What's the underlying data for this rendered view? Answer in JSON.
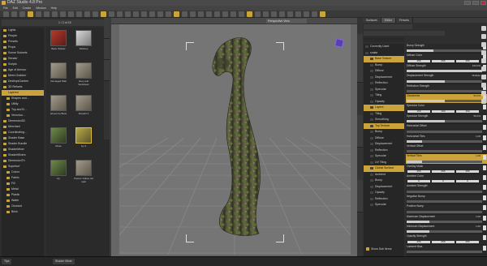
{
  "window": {
    "title": "DAZ Studio 4.8 Pro"
  },
  "menu": [
    "File",
    "Edit",
    "Create",
    "Window",
    "Help"
  ],
  "left_panel": {
    "path_label": "1 / 2 of 15",
    "tree": [
      {
        "label": "Lights"
      },
      {
        "label": "People"
      },
      {
        "label": "Presets"
      },
      {
        "label": "Props"
      },
      {
        "label": "Scene Subsets"
      },
      {
        "label": "Render"
      },
      {
        "label": "Scripts"
      },
      {
        "label": "Age of Armour"
      },
      {
        "label": "Mesh Grabber"
      },
      {
        "label": "DestinysGarden"
      },
      {
        "label": "3D Refuels"
      },
      {
        "label": "Layered",
        "selected": true
      },
      {
        "label": "Shapes and..."
      },
      {
        "label": "Utility"
      },
      {
        "label": "Top and B..."
      },
      {
        "label": "Veronica..."
      },
      {
        "label": "Dimension3D"
      },
      {
        "label": "Merchant"
      },
      {
        "label": "Coordinating..."
      },
      {
        "label": "Shader Base"
      },
      {
        "label": "Shader Bundle"
      },
      {
        "label": "ShaderMixer"
      },
      {
        "label": "ShaderMixers"
      },
      {
        "label": "DimensionTh"
      },
      {
        "label": "Superturf"
      },
      {
        "label": "Colors"
      },
      {
        "label": "Fabric"
      },
      {
        "label": "Fill"
      },
      {
        "label": "Metal"
      },
      {
        "label": "Plastic"
      },
      {
        "label": "Water"
      },
      {
        "label": "Cloward"
      },
      {
        "label": "Brick"
      }
    ],
    "thumbs": [
      {
        "label": "Base Shader"
      },
      {
        "label": "Stitches"
      },
      {
        "label": "Damaged Wall"
      },
      {
        "label": "Grey and Seamless"
      },
      {
        "label": "Ghost Ice Brick"
      },
      {
        "label": "Scratch 2"
      },
      {
        "label": "Moss"
      },
      {
        "label": "Ivy 2"
      },
      {
        "label": "Ivy"
      },
      {
        "label": "Pavers Yellow old wall"
      }
    ]
  },
  "viewport": {
    "view_label": "Perspective View"
  },
  "right_panel": {
    "tabs": [
      "Surfaces",
      "Editor",
      "Presets"
    ],
    "tree": [
      {
        "label": "Currently Used"
      },
      {
        "label": "snake"
      },
      {
        "label": "Base Texture",
        "selected": true
      },
      {
        "label": "Bump"
      },
      {
        "label": "Diffuse"
      },
      {
        "label": "Displacement"
      },
      {
        "label": "Reflection"
      },
      {
        "label": "Specular"
      },
      {
        "label": "Tiling"
      },
      {
        "label": "Opacity"
      },
      {
        "label": "Layers",
        "selected": true
      },
      {
        "label": "Tiling"
      },
      {
        "label": "Smoothing"
      },
      {
        "label": "Top Texture",
        "selected": true
      },
      {
        "label": "Bump"
      },
      {
        "label": "Diffuse"
      },
      {
        "label": "Displacement"
      },
      {
        "label": "Reflection"
      },
      {
        "label": "Specular"
      },
      {
        "label": "UV Tiling"
      },
      {
        "label": "Global Surface",
        "selected": true
      },
      {
        "label": "Ambient"
      },
      {
        "label": "Bump"
      },
      {
        "label": "Displacement"
      },
      {
        "label": "Opacity"
      },
      {
        "label": "Reflection"
      },
      {
        "label": "Specular"
      }
    ],
    "props": [
      {
        "label": "Bump Strength",
        "value": "",
        "fill": 0.35
      },
      {
        "label": "Diffuse Color",
        "value": "",
        "rgb": [
          "255",
          "255",
          "255"
        ]
      },
      {
        "label": "Diffuse Strength",
        "value": "100.0%",
        "fill": 1.0
      },
      {
        "label": "Displacement Strength",
        "value": "Multiple",
        "fill": 0.5
      },
      {
        "label": "Reflection Strength",
        "value": "",
        "fill": 0.0
      },
      {
        "label": "Glossiness",
        "value": "50.0%",
        "fill": 0.5,
        "highlight": true
      },
      {
        "label": "Specular Color",
        "value": "",
        "rgb": [
          "150",
          "150",
          "150"
        ]
      },
      {
        "label": "Specular Strength",
        "value": "50.0%",
        "fill": 0.5
      },
      {
        "label": "Horizontal Offset",
        "value": "",
        "fill": 0.0
      },
      {
        "label": "Horizontal Tiles",
        "value": "1.00",
        "fill": 0.2
      },
      {
        "label": "Vertical Offset",
        "value": "",
        "fill": 0.0
      },
      {
        "label": "Vertical Tiles",
        "value": "1.00",
        "fill": 0.2,
        "highlight": true
      },
      {
        "label": "Overlay Mask",
        "value": "",
        "rgb": [
          "255",
          "255",
          "255"
        ]
      },
      {
        "label": "Ambient Color",
        "value": "",
        "rgb": [
          "0",
          "0",
          "0"
        ]
      },
      {
        "label": "Ambient Strength",
        "value": "",
        "fill": 0.0
      },
      {
        "label": "Negative Bump",
        "value": "",
        "fill": 0.0
      },
      {
        "label": "Positive Bump",
        "value": "",
        "fill": 0.0
      },
      {
        "label": "Maximum Displacement",
        "value": "1.00",
        "fill": 0.3
      },
      {
        "label": "Minimum Displacement",
        "value": "1.00",
        "fill": 0.3
      },
      {
        "label": "Opacity Strength",
        "value": "",
        "rgb": [
          "255",
          "255",
          "255"
        ]
      },
      {
        "label": "Lambert Bias",
        "value": "",
        "fill": 0.0
      }
    ],
    "show_sub_items": "Show Sub Items"
  },
  "bottom": {
    "tabs": [
      "Tips",
      "Shader Mixer"
    ]
  },
  "colors": {
    "accent": "#caa43a",
    "viewport_bg": "#757575",
    "panel_bg": "#2f2f2f"
  }
}
